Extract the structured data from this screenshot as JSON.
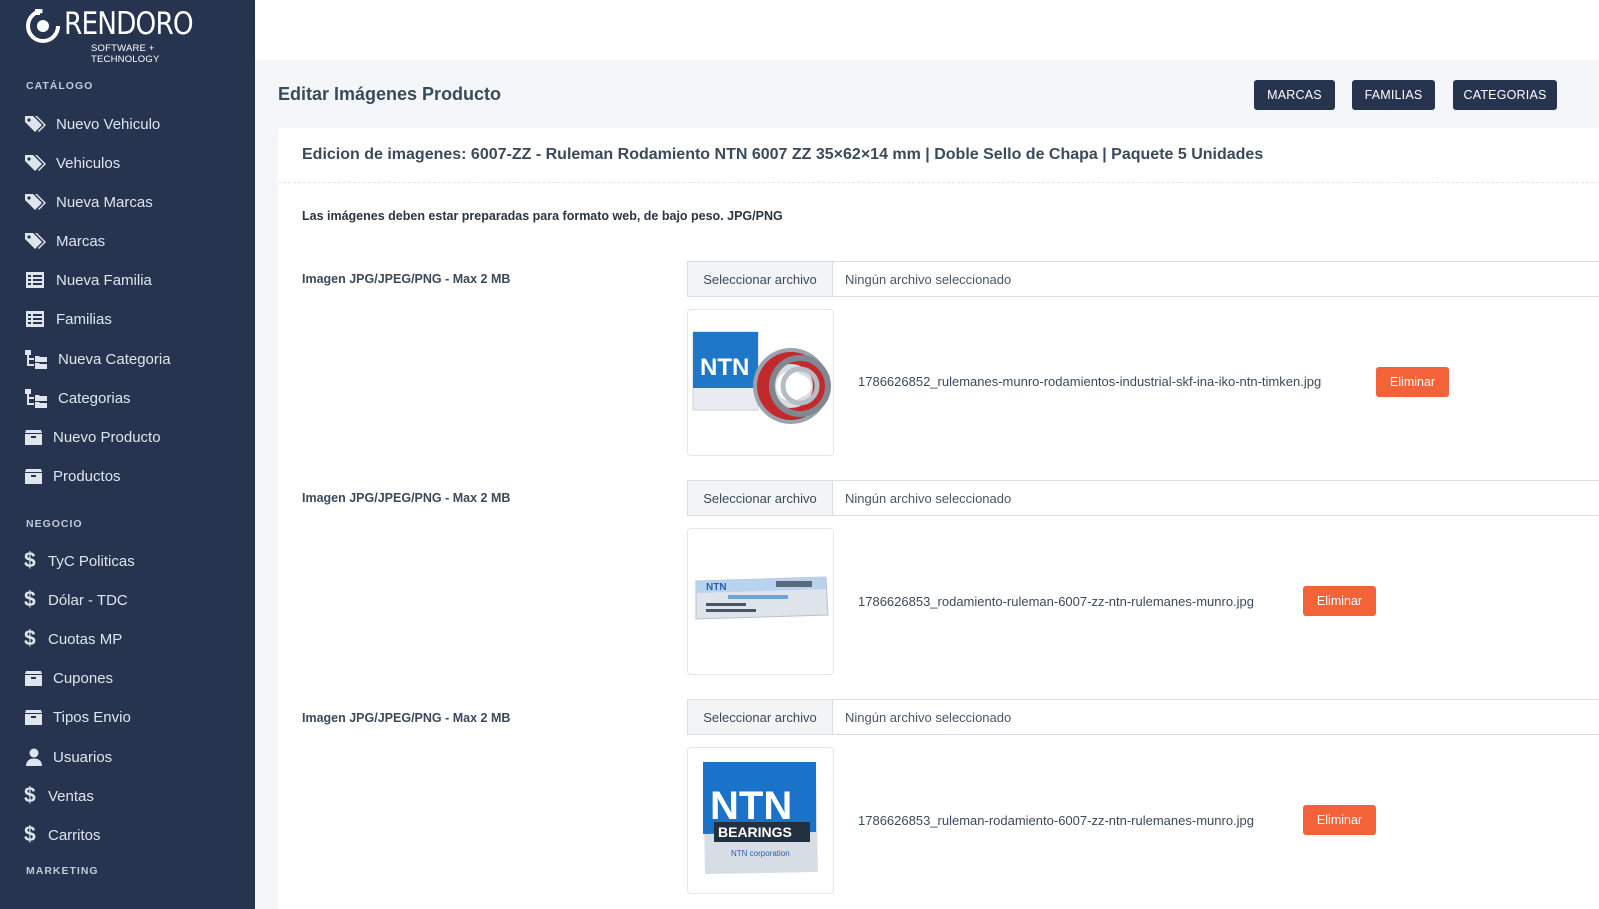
{
  "brand": {
    "name": "RENDORO",
    "tagline": "SOFTWARE + TECHNOLOGY"
  },
  "sidebar": {
    "sections": [
      {
        "title": "CATÁLOGO"
      },
      {
        "title": "NEGOCIO"
      },
      {
        "title": "MARKETING"
      }
    ],
    "items": [
      {
        "label": "Nuevo Vehiculo",
        "icon": "tags-icon"
      },
      {
        "label": "Vehiculos",
        "icon": "tags-icon"
      },
      {
        "label": "Nueva Marcas",
        "icon": "tags-icon"
      },
      {
        "label": "Marcas",
        "icon": "tags-icon"
      },
      {
        "label": "Nueva Familia",
        "icon": "list-table-icon"
      },
      {
        "label": "Familias",
        "icon": "list-table-icon"
      },
      {
        "label": "Nueva Categoria",
        "icon": "folder-tree-icon"
      },
      {
        "label": "Categorias",
        "icon": "folder-tree-icon"
      },
      {
        "label": "Nuevo Producto",
        "icon": "box-icon"
      },
      {
        "label": "Productos",
        "icon": "box-icon"
      },
      {
        "label": "TyC Politicas",
        "icon": "dollar-icon"
      },
      {
        "label": "Dólar - TDC",
        "icon": "dollar-icon"
      },
      {
        "label": "Cuotas MP",
        "icon": "dollar-icon"
      },
      {
        "label": "Cupones",
        "icon": "box-icon"
      },
      {
        "label": "Tipos Envio",
        "icon": "box-icon"
      },
      {
        "label": "Usuarios",
        "icon": "user-icon"
      },
      {
        "label": "Ventas",
        "icon": "dollar-icon"
      },
      {
        "label": "Carritos",
        "icon": "dollar-icon"
      }
    ]
  },
  "header": {
    "title": "Editar Imágenes Producto",
    "buttons": {
      "marcas": "MARCAS",
      "familias": "FAMILIAS",
      "categorias": "CATEGORIAS"
    }
  },
  "card": {
    "title": "Edicion de imagenes: 6007-ZZ - Ruleman Rodamiento NTN 6007 ZZ 35×62×14 mm | Doble Sello de Chapa | Paquete 5 Unidades",
    "note": "Las imágenes deben estar preparadas para formato web, de bajo peso. JPG/PNG"
  },
  "images": [
    {
      "label": "Imagen JPG/JPEG/PNG - Max 2 MB",
      "button": "Seleccionar archivo",
      "status": "Ningún archivo seleccionado",
      "filename": "1786626852_rulemanes-munro-rodamientos-industrial-skf-ina-iko-ntn-timken.jpg",
      "delete": "Eliminar"
    },
    {
      "label": "Imagen JPG/JPEG/PNG - Max 2 MB",
      "button": "Seleccionar archivo",
      "status": "Ningún archivo seleccionado",
      "filename": "1786626853_rodamiento-ruleman-6007-zz-ntn-rulemanes-munro.jpg",
      "delete": "Eliminar"
    },
    {
      "label": "Imagen JPG/JPEG/PNG - Max 2 MB",
      "button": "Seleccionar archivo",
      "status": "Ningún archivo seleccionado",
      "filename": "1786626853_ruleman-rodamiento-6007-zz-ntn-rulemanes-munro.jpg",
      "delete": "Eliminar"
    }
  ],
  "product_images": {
    "box_brand": "NTN",
    "box_word": "BEARINGS",
    "box_small": "NTN corporation"
  },
  "colors": {
    "sidebar": "#26344f",
    "primary_button": "#26344f",
    "danger_button": "#f4623a",
    "background": "#f4f6fa"
  }
}
